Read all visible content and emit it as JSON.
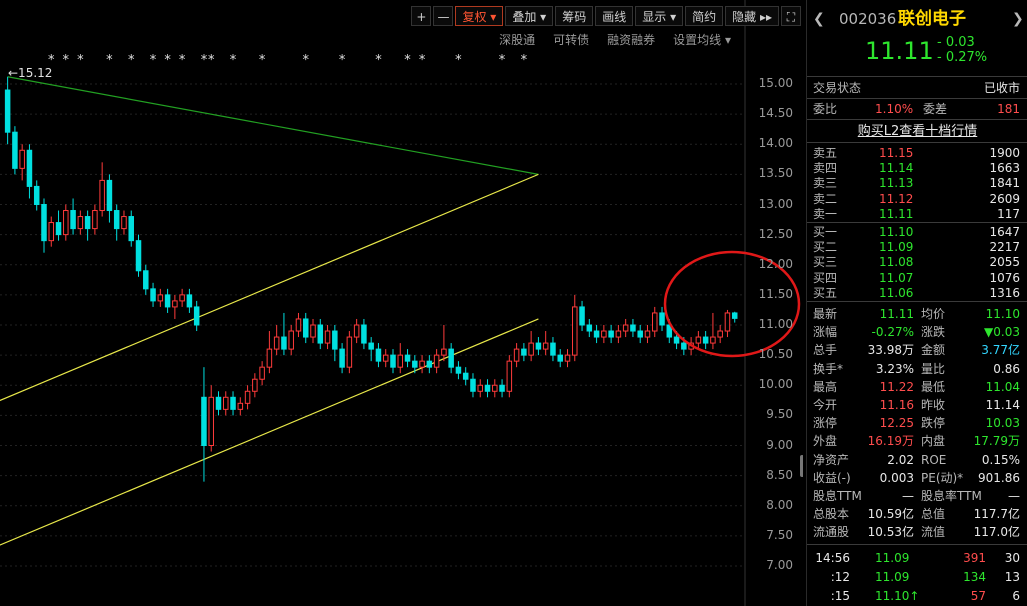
{
  "toolbar": {
    "plus": "+",
    "minus": "—",
    "fuquan": "复权",
    "diejia": "叠加",
    "chouma": "筹码",
    "huaxian": "画线",
    "xianshi": "显示",
    "jianyue": "简约",
    "yincang": "隐藏",
    "more": "▸▸",
    "expand": "⛶"
  },
  "subtoolbar": {
    "shengutong": "深股通",
    "kezhuanzhai": "可转债",
    "rongzirongquan": "融资融券",
    "shezhi_junxian": "设置均线 ▾"
  },
  "chart": {
    "max_label": "←15.12",
    "marker": "*"
  },
  "chart_data": {
    "type": "candlestick",
    "ylim": [
      7.0,
      15.2
    ],
    "yticks": [
      "15.00",
      "14.50",
      "14.00",
      "13.50",
      "13.00",
      "12.50",
      "12.00",
      "11.50",
      "11.00",
      "10.50",
      "10.00",
      "9.50",
      "9.00",
      "8.50",
      "8.00",
      "7.50",
      "7.00"
    ],
    "ytick_values": [
      15.0,
      14.5,
      14.0,
      13.5,
      13.0,
      12.5,
      12.0,
      11.5,
      11.0,
      10.5,
      10.0,
      9.5,
      9.0,
      8.5,
      8.0,
      7.5,
      7.0
    ],
    "colors": {
      "up": "#ff3b3b",
      "down": "#00e0e0",
      "grid": "#222222"
    },
    "candles": [
      [
        14.9,
        14.2,
        15.12,
        14.0
      ],
      [
        14.2,
        13.6,
        14.3,
        13.5
      ],
      [
        13.6,
        13.9,
        14.0,
        13.4
      ],
      [
        13.9,
        13.3,
        14.0,
        13.1
      ],
      [
        13.3,
        13.0,
        13.4,
        12.9
      ],
      [
        13.0,
        12.4,
        13.1,
        12.2
      ],
      [
        12.4,
        12.7,
        12.8,
        12.3
      ],
      [
        12.7,
        12.5,
        12.9,
        12.4
      ],
      [
        12.5,
        12.9,
        13.0,
        12.4
      ],
      [
        12.9,
        12.6,
        13.1,
        12.5
      ],
      [
        12.6,
        12.8,
        12.9,
        12.5
      ],
      [
        12.8,
        12.6,
        12.9,
        12.4
      ],
      [
        12.6,
        12.9,
        13.0,
        12.5
      ],
      [
        12.9,
        13.4,
        13.7,
        12.8
      ],
      [
        13.4,
        12.9,
        13.5,
        12.7
      ],
      [
        12.9,
        12.6,
        13.0,
        12.4
      ],
      [
        12.6,
        12.8,
        12.9,
        12.5
      ],
      [
        12.8,
        12.4,
        12.9,
        12.3
      ],
      [
        12.4,
        11.9,
        12.5,
        11.8
      ],
      [
        11.9,
        11.6,
        12.0,
        11.5
      ],
      [
        11.6,
        11.4,
        11.7,
        11.3
      ],
      [
        11.4,
        11.5,
        11.6,
        11.3
      ],
      [
        11.5,
        11.3,
        11.6,
        11.2
      ],
      [
        11.3,
        11.4,
        11.5,
        11.1
      ],
      [
        11.4,
        11.5,
        11.6,
        11.3
      ],
      [
        11.5,
        11.3,
        11.6,
        11.2
      ],
      [
        11.3,
        11.0,
        11.4,
        10.9
      ],
      [
        9.8,
        9.0,
        10.3,
        8.4
      ],
      [
        9.0,
        9.8,
        10.0,
        8.9
      ],
      [
        9.8,
        9.6,
        9.9,
        9.5
      ],
      [
        9.6,
        9.8,
        9.9,
        9.5
      ],
      [
        9.8,
        9.6,
        9.9,
        9.5
      ],
      [
        9.6,
        9.7,
        9.8,
        9.5
      ],
      [
        9.7,
        9.9,
        10.0,
        9.6
      ],
      [
        9.9,
        10.1,
        10.2,
        9.8
      ],
      [
        10.1,
        10.3,
        10.4,
        10.0
      ],
      [
        10.3,
        10.6,
        10.9,
        10.2
      ],
      [
        10.6,
        10.8,
        11.0,
        10.5
      ],
      [
        10.8,
        10.6,
        11.2,
        10.5
      ],
      [
        10.6,
        10.9,
        11.0,
        10.5
      ],
      [
        10.9,
        11.1,
        11.2,
        10.8
      ],
      [
        11.1,
        10.8,
        11.2,
        10.7
      ],
      [
        10.8,
        11.0,
        11.1,
        10.7
      ],
      [
        11.0,
        10.7,
        11.1,
        10.6
      ],
      [
        10.7,
        10.9,
        11.0,
        10.6
      ],
      [
        10.9,
        10.6,
        11.0,
        10.4
      ],
      [
        10.6,
        10.3,
        10.7,
        10.2
      ],
      [
        10.3,
        10.8,
        10.9,
        10.2
      ],
      [
        10.8,
        11.0,
        11.1,
        10.7
      ],
      [
        11.0,
        10.7,
        11.1,
        10.6
      ],
      [
        10.7,
        10.6,
        10.8,
        10.4
      ],
      [
        10.6,
        10.4,
        10.7,
        10.3
      ],
      [
        10.4,
        10.5,
        10.6,
        10.3
      ],
      [
        10.5,
        10.3,
        10.6,
        10.2
      ],
      [
        10.3,
        10.5,
        10.7,
        10.2
      ],
      [
        10.5,
        10.4,
        10.6,
        10.3
      ],
      [
        10.4,
        10.3,
        10.5,
        10.2
      ],
      [
        10.3,
        10.4,
        10.5,
        10.2
      ],
      [
        10.4,
        10.3,
        10.5,
        10.2
      ],
      [
        10.3,
        10.5,
        10.6,
        10.2
      ],
      [
        10.5,
        10.6,
        11.0,
        10.4
      ],
      [
        10.6,
        10.3,
        10.7,
        10.2
      ],
      [
        10.3,
        10.2,
        10.4,
        10.1
      ],
      [
        10.2,
        10.1,
        10.3,
        10.0
      ],
      [
        10.1,
        9.9,
        10.2,
        9.8
      ],
      [
        9.9,
        10.0,
        10.1,
        9.8
      ],
      [
        10.0,
        9.9,
        10.1,
        9.8
      ],
      [
        9.9,
        10.0,
        10.1,
        9.8
      ],
      [
        10.0,
        9.9,
        10.1,
        9.8
      ],
      [
        9.9,
        10.4,
        10.5,
        9.8
      ],
      [
        10.4,
        10.6,
        10.7,
        10.3
      ],
      [
        10.6,
        10.5,
        10.7,
        10.4
      ],
      [
        10.5,
        10.7,
        10.9,
        10.4
      ],
      [
        10.7,
        10.6,
        10.8,
        10.5
      ],
      [
        10.6,
        10.7,
        10.9,
        10.5
      ],
      [
        10.7,
        10.5,
        10.8,
        10.4
      ],
      [
        10.5,
        10.4,
        10.6,
        10.3
      ],
      [
        10.4,
        10.5,
        10.6,
        10.3
      ],
      [
        10.5,
        11.3,
        11.5,
        10.4
      ],
      [
        11.3,
        11.0,
        11.4,
        10.9
      ],
      [
        11.0,
        10.9,
        11.1,
        10.8
      ],
      [
        10.9,
        10.8,
        11.0,
        10.7
      ],
      [
        10.8,
        10.9,
        11.0,
        10.7
      ],
      [
        10.9,
        10.8,
        11.0,
        10.7
      ],
      [
        10.8,
        10.9,
        11.0,
        10.7
      ],
      [
        10.9,
        11.0,
        11.1,
        10.8
      ],
      [
        11.0,
        10.9,
        11.1,
        10.8
      ],
      [
        10.9,
        10.8,
        11.0,
        10.7
      ],
      [
        10.8,
        10.9,
        11.0,
        10.7
      ],
      [
        10.9,
        11.2,
        11.3,
        10.8
      ],
      [
        11.2,
        11.0,
        11.3,
        10.9
      ],
      [
        11.0,
        10.8,
        11.1,
        10.7
      ],
      [
        10.8,
        10.7,
        10.9,
        10.6
      ],
      [
        10.7,
        10.6,
        10.8,
        10.5
      ],
      [
        10.6,
        10.7,
        10.8,
        10.5
      ],
      [
        10.7,
        10.8,
        10.9,
        10.6
      ],
      [
        10.8,
        10.7,
        10.9,
        10.6
      ],
      [
        10.7,
        10.8,
        11.2,
        10.6
      ],
      [
        10.8,
        10.9,
        11.0,
        10.7
      ],
      [
        10.9,
        11.2,
        11.25,
        10.8
      ],
      [
        11.2,
        11.11,
        11.22,
        11.04
      ]
    ],
    "lines": [
      {
        "color": "#22a022",
        "from": [
          0,
          15.12
        ],
        "to": [
          73,
          13.5
        ]
      },
      {
        "color": "#e8e84a",
        "from": [
          -2,
          9.7
        ],
        "to": [
          73,
          13.5
        ]
      },
      {
        "color": "#e8e84a",
        "from": [
          -2,
          7.3
        ],
        "to": [
          73,
          11.1
        ]
      }
    ],
    "marker_indices": [
      6,
      8,
      10,
      14,
      17,
      20,
      22,
      24,
      27,
      28,
      31,
      35,
      41,
      46,
      51,
      55,
      57,
      62,
      68,
      71
    ]
  },
  "quote": {
    "code": "002036",
    "name": "联创电子",
    "price": "11.11",
    "change": "- 0.03",
    "change_pct": "- 0.27%",
    "status_label": "交易状态",
    "status_value": "已收市",
    "weibi_label": "委比",
    "weibi_value": "1.10%",
    "weicha_label": "委差",
    "weicha_value": "181",
    "l2_link": "购买L2查看十档行情",
    "sell": [
      {
        "label": "卖五",
        "price": "11.15",
        "vol": "1900"
      },
      {
        "label": "卖四",
        "price": "11.14",
        "vol": "1663"
      },
      {
        "label": "卖三",
        "price": "11.13",
        "vol": "1841"
      },
      {
        "label": "卖二",
        "price": "11.12",
        "vol": "2609"
      },
      {
        "label": "卖一",
        "price": "11.11",
        "vol": "117"
      }
    ],
    "buy": [
      {
        "label": "买一",
        "price": "11.10",
        "vol": "1647"
      },
      {
        "label": "买二",
        "price": "11.09",
        "vol": "2217"
      },
      {
        "label": "买三",
        "price": "11.08",
        "vol": "2055"
      },
      {
        "label": "买四",
        "price": "11.07",
        "vol": "1076"
      },
      {
        "label": "买五",
        "price": "11.06",
        "vol": "1316"
      }
    ],
    "stats": [
      {
        "l1": "最新",
        "v1": "11.11",
        "c1": "green",
        "l2": "均价",
        "v2": "11.10",
        "c2": "green"
      },
      {
        "l1": "涨幅",
        "v1": "-0.27%",
        "c1": "green",
        "l2": "涨跌",
        "v2": "▼0.03",
        "c2": "green"
      },
      {
        "l1": "总手",
        "v1": "33.98万",
        "c1": "white",
        "l2": "金额",
        "v2": "3.77亿",
        "c2": "cyan"
      },
      {
        "l1": "换手*",
        "v1": "3.23%",
        "c1": "white",
        "l2": "量比",
        "v2": "0.86",
        "c2": "white"
      },
      {
        "l1": "最高",
        "v1": "11.22",
        "c1": "red",
        "l2": "最低",
        "v2": "11.04",
        "c2": "green"
      },
      {
        "l1": "今开",
        "v1": "11.16",
        "c1": "red",
        "l2": "昨收",
        "v2": "11.14",
        "c2": "white"
      },
      {
        "l1": "涨停",
        "v1": "12.25",
        "c1": "red",
        "l2": "跌停",
        "v2": "10.03",
        "c2": "green"
      },
      {
        "l1": "外盘",
        "v1": "16.19万",
        "c1": "red",
        "l2": "内盘",
        "v2": "17.79万",
        "c2": "green"
      },
      {
        "l1": "净资产",
        "v1": "2.02",
        "c1": "white",
        "l2": "ROE",
        "v2": "0.15%",
        "c2": "white"
      },
      {
        "l1": "收益(-)",
        "v1": "0.003",
        "c1": "white",
        "l2": "PE(动)*",
        "v2": "901.86",
        "c2": "white"
      },
      {
        "l1": "股息TTM",
        "v1": "—",
        "c1": "white",
        "l2": "股息率TTM",
        "v2": "—",
        "c2": "white"
      },
      {
        "l1": "总股本",
        "v1": "10.59亿",
        "c1": "white",
        "l2": "总值",
        "v2": "117.7亿",
        "c2": "white"
      },
      {
        "l1": "流通股",
        "v1": "10.53亿",
        "c1": "white",
        "l2": "流值",
        "v2": "117.0亿",
        "c2": "white"
      }
    ],
    "ticks": [
      {
        "time": "14:56",
        "price": "11.09",
        "vol": "391",
        "num": "30",
        "vc": "red"
      },
      {
        "time": ":12",
        "price": "11.09",
        "vol": "134",
        "num": "13",
        "vc": "green"
      },
      {
        "time": ":15",
        "price": "11.10↑",
        "vol": "57",
        "num": "6",
        "vc": "red"
      }
    ]
  }
}
